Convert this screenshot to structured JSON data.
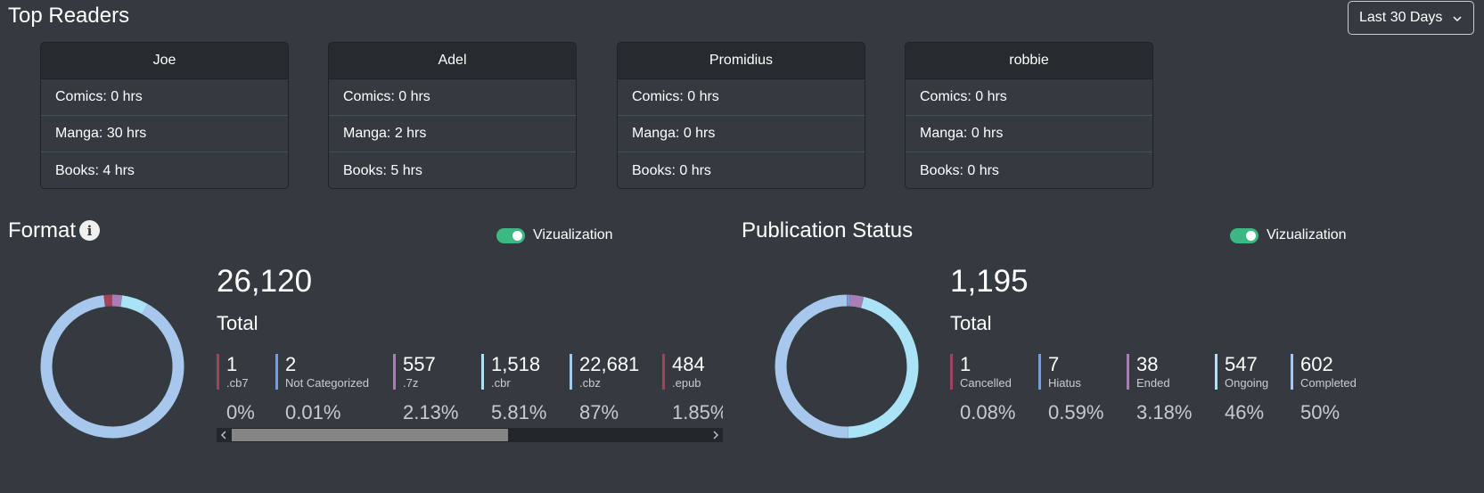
{
  "top_readers": {
    "title": "Top Readers",
    "range": "Last 30 Days",
    "readers": [
      {
        "name": "Joe",
        "comics": "Comics: 0 hrs",
        "manga": "Manga: 30 hrs",
        "books": "Books: 4 hrs"
      },
      {
        "name": "Adel",
        "comics": "Comics: 0 hrs",
        "manga": "Manga: 2 hrs",
        "books": "Books: 5 hrs"
      },
      {
        "name": "Promidius",
        "comics": "Comics: 0 hrs",
        "manga": "Manga: 0 hrs",
        "books": "Books: 0 hrs"
      },
      {
        "name": "robbie",
        "comics": "Comics: 0 hrs",
        "manga": "Manga: 0 hrs",
        "books": "Books: 0 hrs"
      }
    ]
  },
  "format": {
    "title": "Format",
    "info_icon": "info-icon",
    "toggle_label": "Vizualization",
    "total": "26,120",
    "total_label": "Total",
    "items": [
      {
        "value": "1",
        "name": ".cb7",
        "pct": "0%",
        "color": "#a0435b"
      },
      {
        "value": "2",
        "name": "Not Categorized",
        "pct": "0.01%",
        "color": "#6f9ee3"
      },
      {
        "value": "557",
        "name": ".7z",
        "pct": "2.13%",
        "color": "#a77fb4"
      },
      {
        "value": "1,518",
        "name": ".cbr",
        "pct": "5.81%",
        "color": "#a9e3f5"
      },
      {
        "value": "22,681",
        "name": ".cbz",
        "pct": "87%",
        "color": "#9ccdf1"
      },
      {
        "value": "484",
        "name": ".epub",
        "pct": "1.85%",
        "color": "#a0435b"
      }
    ]
  },
  "publication": {
    "title": "Publication Status",
    "toggle_label": "Vizualization",
    "total": "1,195",
    "total_label": "Total",
    "items": [
      {
        "value": "1",
        "name": "Cancelled",
        "pct": "0.08%",
        "color": "#a0435b"
      },
      {
        "value": "7",
        "name": "Hiatus",
        "pct": "0.59%",
        "color": "#6f9ee3"
      },
      {
        "value": "38",
        "name": "Ended",
        "pct": "3.18%",
        "color": "#a77fb4"
      },
      {
        "value": "547",
        "name": "Ongoing",
        "pct": "46%",
        "color": "#a9e3f5"
      },
      {
        "value": "602",
        "name": "Completed",
        "pct": "50%",
        "color": "#a7c7ec"
      }
    ]
  },
  "chart_data": [
    {
      "type": "pie",
      "categories": [
        ".cb7",
        "Not Categorized",
        ".7z",
        ".cbr",
        ".cbz",
        ".epub"
      ],
      "values": [
        1,
        2,
        557,
        1518,
        22681,
        484
      ],
      "colors": [
        "#a0435b",
        "#6f9ee3",
        "#a77fb4",
        "#a9e3f5",
        "#a7c7ec",
        "#a0435b"
      ]
    },
    {
      "type": "pie",
      "categories": [
        "Cancelled",
        "Hiatus",
        "Ended",
        "Ongoing",
        "Completed"
      ],
      "values": [
        1,
        7,
        38,
        547,
        602
      ],
      "colors": [
        "#a0435b",
        "#6f9ee3",
        "#a77fb4",
        "#a9e3f5",
        "#a7c7ec"
      ]
    }
  ]
}
